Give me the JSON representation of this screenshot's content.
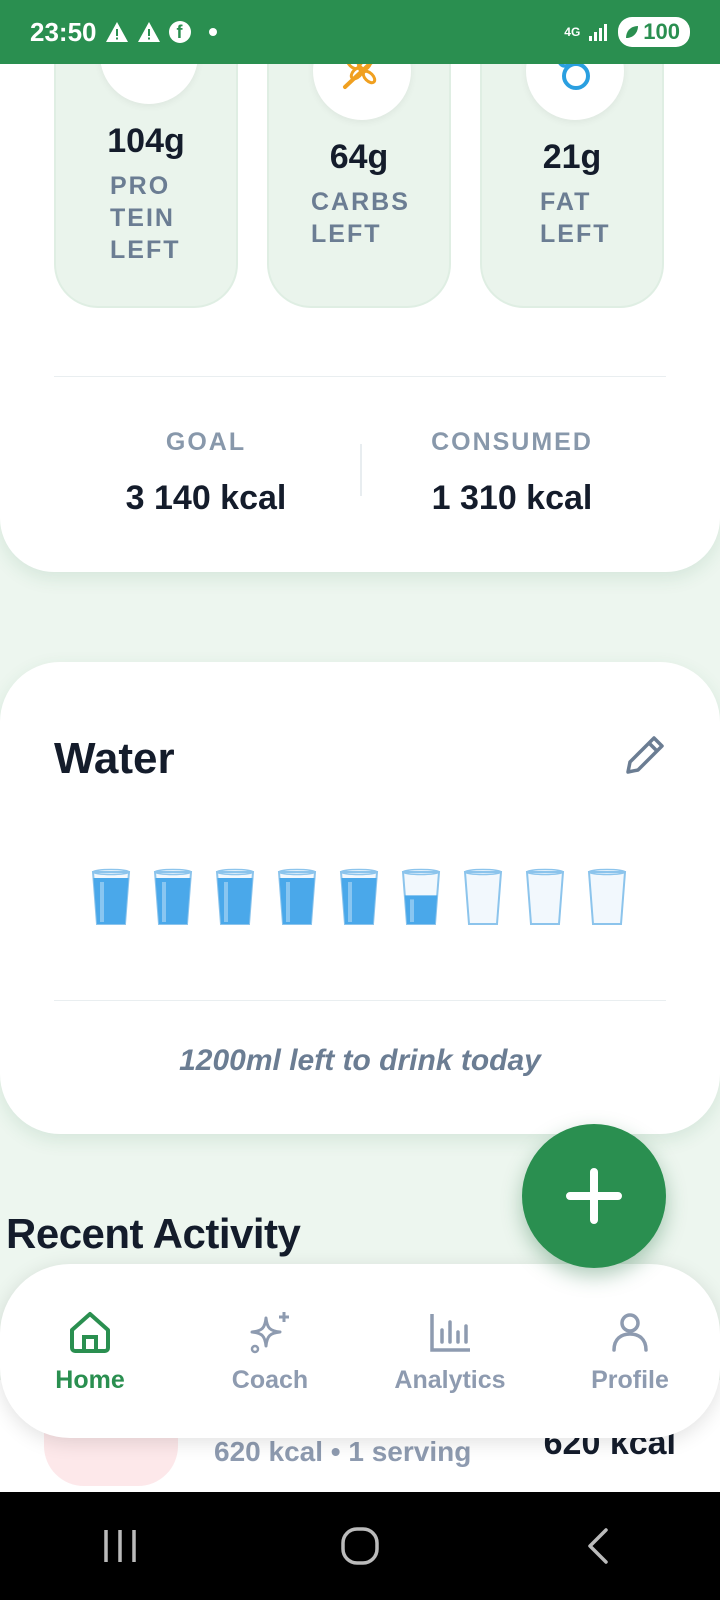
{
  "status_bar": {
    "time": "23:50",
    "network": "4G",
    "battery": "100"
  },
  "macros": [
    {
      "value": "104g",
      "label_lines": [
        "PRO",
        "TEIN",
        "LEFT"
      ],
      "color": "#e8514a",
      "icon": "protein-icon"
    },
    {
      "value": "64g",
      "label_lines": [
        "CARBS",
        "LEFT"
      ],
      "color": "#f0a020",
      "icon": "wheat-icon"
    },
    {
      "value": "21g",
      "label_lines": [
        "FAT",
        "LEFT"
      ],
      "color": "#2a9fe0",
      "icon": "fat-drops-icon"
    }
  ],
  "kcal": {
    "goal_label": "GOAL",
    "goal_value": "3 140 kcal",
    "consumed_label": "CONSUMED",
    "consumed_value": "1 310 kcal"
  },
  "water": {
    "title": "Water",
    "glasses_total": 9,
    "glasses_full": 5,
    "glasses_half": 1,
    "note": "1200ml left to drink today"
  },
  "recent": {
    "title": "Recent Activity",
    "item_sub": "620 kcal • 1 serving",
    "item_kcal": "620 kcal"
  },
  "nav": {
    "items": [
      {
        "label": "Home",
        "icon": "home-icon",
        "active": true
      },
      {
        "label": "Coach",
        "icon": "sparkle-icon",
        "active": false
      },
      {
        "label": "Analytics",
        "icon": "bar-chart-icon",
        "active": false
      },
      {
        "label": "Profile",
        "icon": "person-icon",
        "active": false
      }
    ]
  },
  "colors": {
    "brand_green": "#2a8f50",
    "water_blue": "#4aa8ea"
  }
}
